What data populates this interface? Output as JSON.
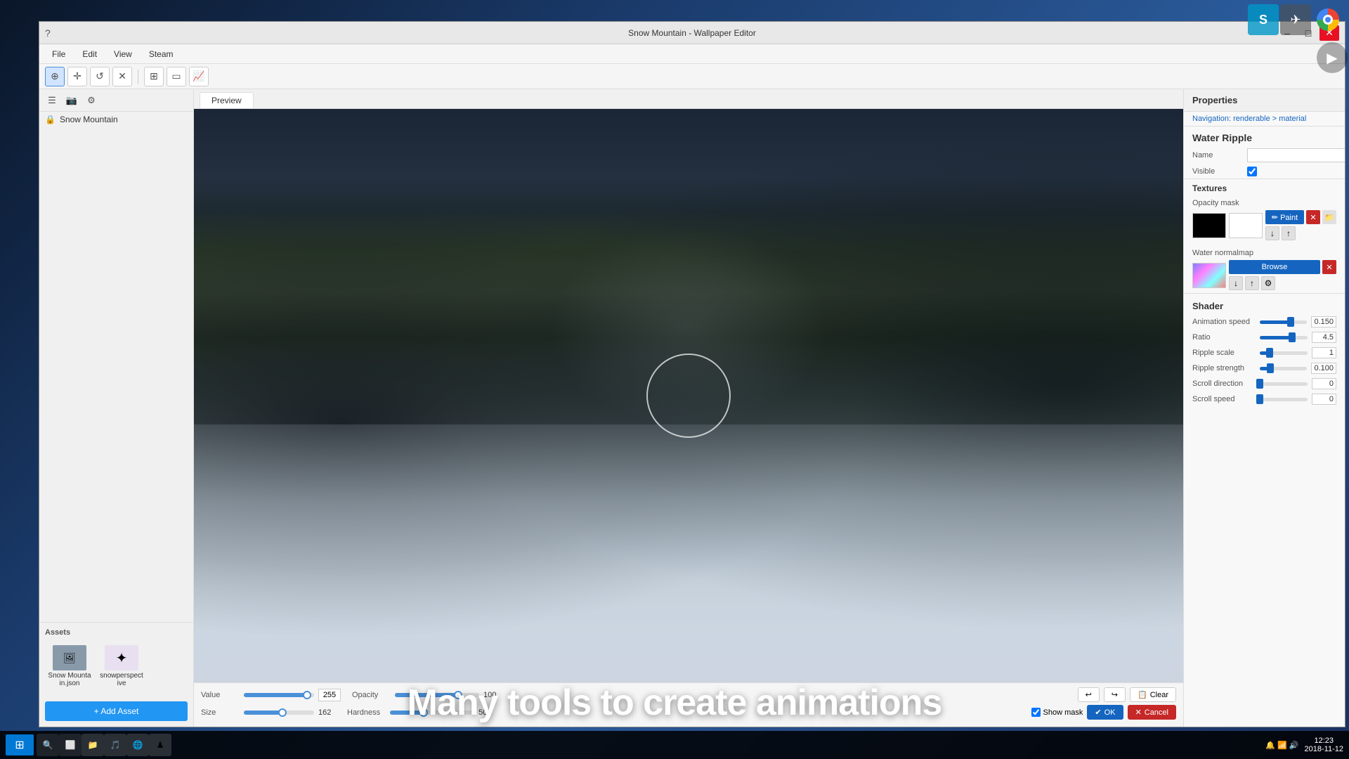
{
  "window": {
    "title": "Snow Mountain - Wallpaper Editor",
    "menus": [
      "File",
      "Edit",
      "View",
      "Steam"
    ]
  },
  "sidebar": {
    "item_label": "Snow Mountain",
    "add_asset_btn": "+ Add Asset",
    "assets_label": "Assets",
    "assets": [
      {
        "name": "Snow Mountain.json",
        "icon": "🖼"
      },
      {
        "name": "snowperspective",
        "icon": "✦"
      }
    ]
  },
  "preview_tab": "Preview",
  "tools": {
    "icons": [
      "⊕",
      "✛",
      "↺",
      "✕",
      "⊞",
      "▭",
      "📈"
    ]
  },
  "brush_controls": {
    "value_label": "Value",
    "value_num": "255",
    "size_label": "Size",
    "size_num": "162",
    "opacity_label": "Opacity",
    "opacity_num": "100",
    "hardness_label": "Hardness",
    "hardness_num": "50",
    "show_mask_label": "Show mask",
    "clear_btn": "Clear",
    "ok_btn": "OK",
    "cancel_btn": "Cancel"
  },
  "properties": {
    "title": "Properties",
    "nav": "renderable > material",
    "section_title": "Water Ripple",
    "name_label": "Name",
    "visible_label": "Visible",
    "textures_label": "Textures",
    "opacity_mask_label": "Opacity mask",
    "paint_btn": "✏ Paint",
    "browse_btn": "Browse",
    "water_normalmap_label": "Water normalmap",
    "shader_label": "Shader",
    "shader_rows": [
      {
        "name": "Animation speed",
        "value": "0.150",
        "fill_pct": 65
      },
      {
        "name": "Ratio",
        "value": "4.5",
        "fill_pct": 68
      },
      {
        "name": "Ripple scale",
        "value": "1",
        "fill_pct": 20
      },
      {
        "name": "Ripple strength",
        "value": "0.100",
        "fill_pct": 22
      },
      {
        "name": "Scroll direction",
        "value": "0",
        "fill_pct": 0
      },
      {
        "name": "Scroll speed",
        "value": "0",
        "fill_pct": 0
      }
    ]
  },
  "overlay_text": "Many tools to create animations",
  "taskbar": {
    "time": "12:23",
    "date": "2018-11-12"
  }
}
